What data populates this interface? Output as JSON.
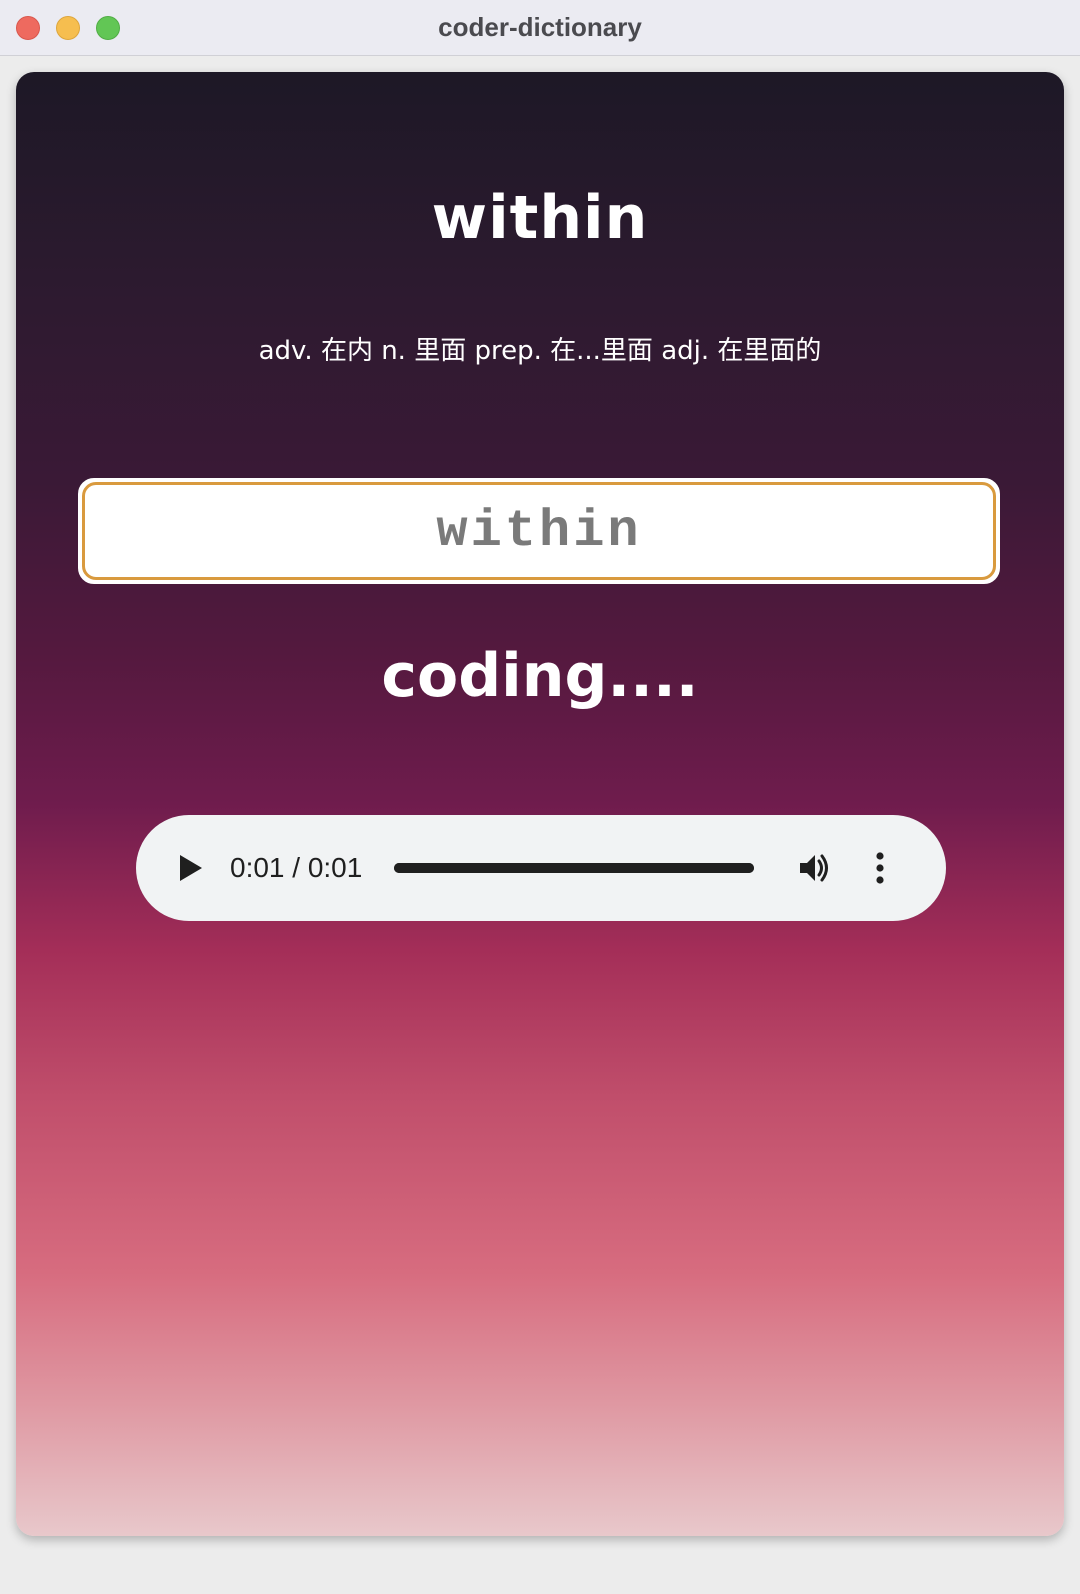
{
  "window": {
    "title": "coder-dictionary"
  },
  "main": {
    "word": "within",
    "translation": "adv. 在内 n. 里面 prep. 在...里面 adj. 在里面的",
    "input_value": "within",
    "status": "coding...."
  },
  "audio": {
    "time_display": "0:01 / 0:01",
    "progress": 1.0,
    "icons": {
      "play": "play-icon",
      "volume": "volume-icon",
      "more": "more-vertical-icon"
    }
  },
  "colors": {
    "input_border": "#d99a3e",
    "gradient_top": "#1d1826",
    "gradient_bottom": "#e8c8cb"
  }
}
